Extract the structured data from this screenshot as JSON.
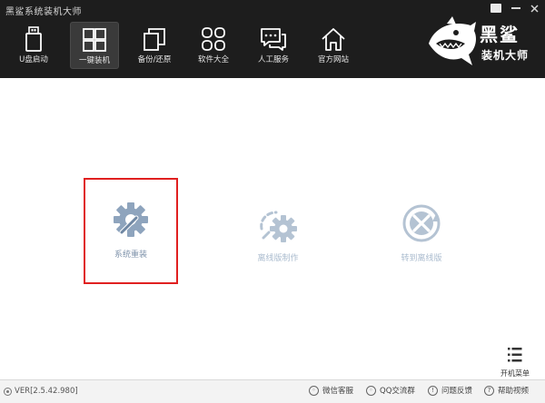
{
  "window": {
    "title": "黑鲨系统装机大师"
  },
  "nav": {
    "items": [
      {
        "label": "U盘启动",
        "icon": "usb-drive-icon"
      },
      {
        "label": "一键装机",
        "icon": "windows-icon",
        "active": true
      },
      {
        "label": "备份/还原",
        "icon": "backup-copy-icon"
      },
      {
        "label": "软件大全",
        "icon": "apps-grid-icon"
      },
      {
        "label": "人工服务",
        "icon": "chat-icon"
      },
      {
        "label": "官方网站",
        "icon": "home-icon"
      }
    ]
  },
  "logo": {
    "line1": "黑鲨",
    "line2": "装机大师"
  },
  "main": {
    "features": [
      {
        "label": "系统重装",
        "icon": "gear-wrench-icon",
        "selected": true
      },
      {
        "label": "离线版制作",
        "icon": "offline-gear-icon"
      },
      {
        "label": "转到离线版",
        "icon": "tools-refresh-icon"
      }
    ],
    "boot_menu_label": "开机菜单"
  },
  "footer": {
    "version": "VER[2.5.42.980]",
    "links": [
      {
        "label": "微信客服",
        "icon": "wechat-icon"
      },
      {
        "label": "QQ交流群",
        "icon": "qq-icon"
      },
      {
        "label": "问题反馈",
        "icon": "feedback-icon"
      },
      {
        "label": "帮助视频",
        "icon": "help-icon"
      }
    ]
  },
  "colors": {
    "header_bg": "#1d1d1d",
    "accent_red": "#e02020",
    "feature_icon": "#8ea4bd"
  }
}
